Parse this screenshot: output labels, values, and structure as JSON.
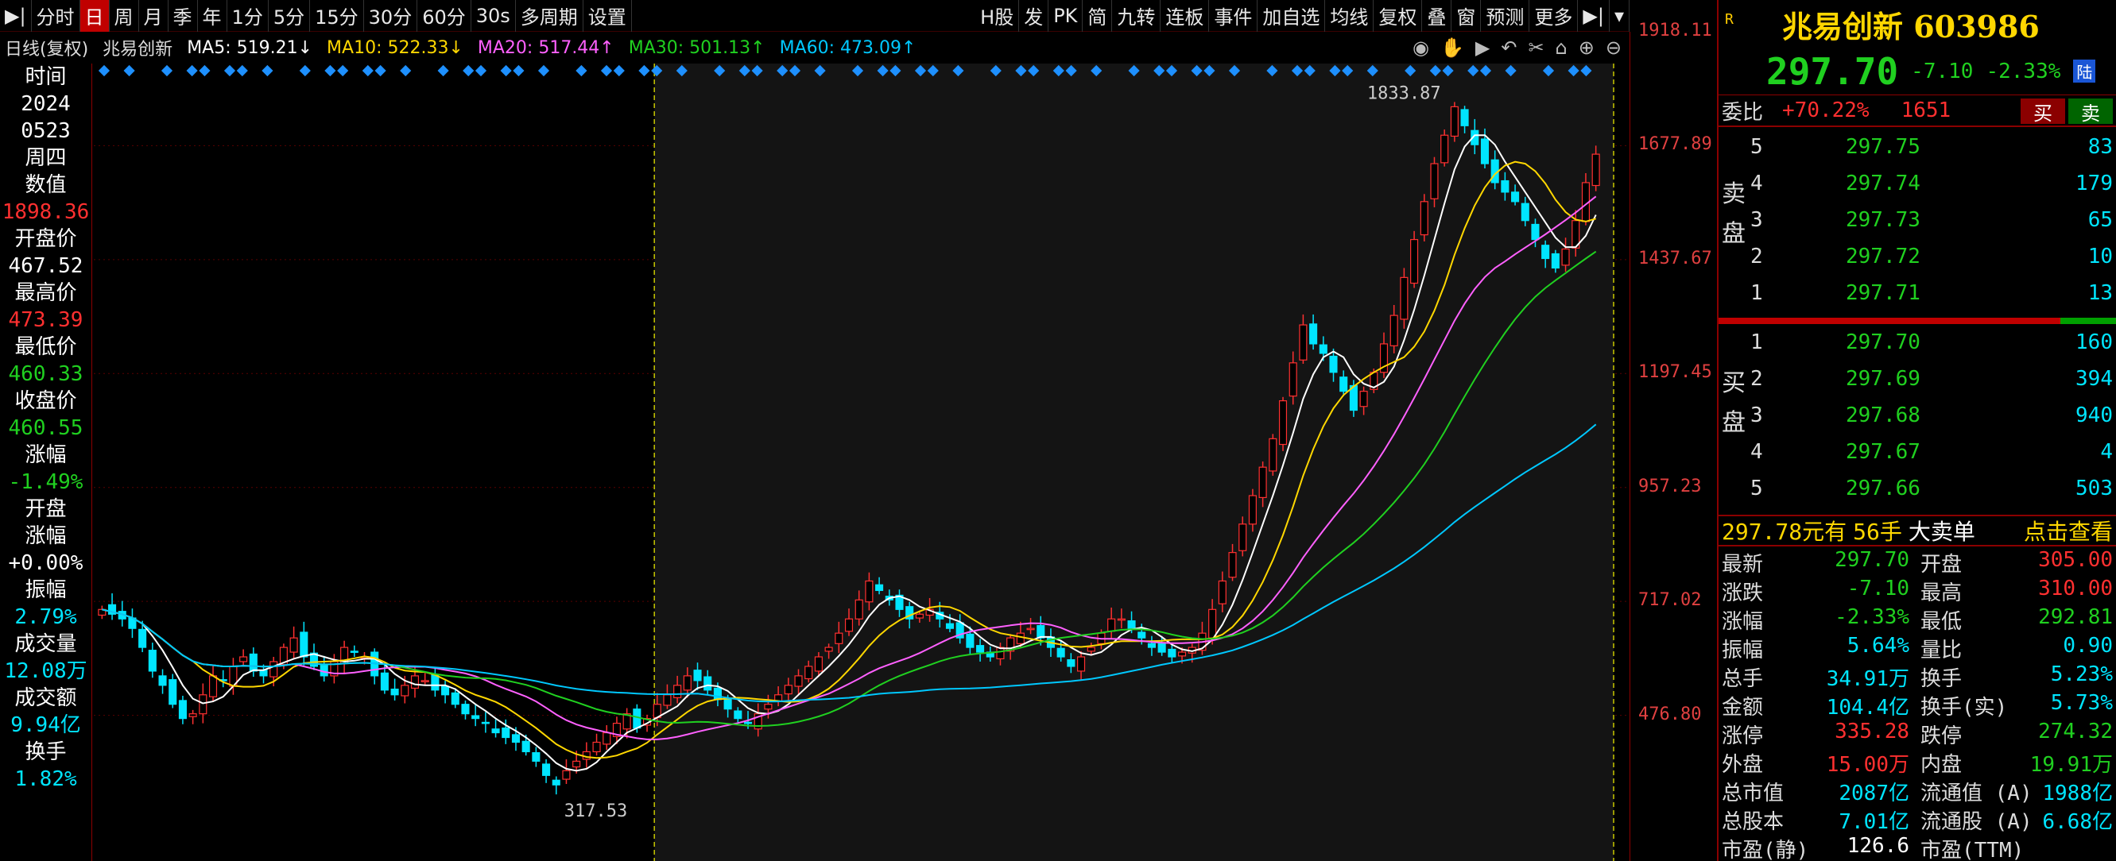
{
  "toolbar": {
    "periods": [
      "分时",
      "日",
      "周",
      "月",
      "季",
      "年",
      "1分",
      "5分",
      "15分",
      "30分",
      "60分",
      "30s",
      "多周期",
      "设置"
    ],
    "active_period": "日",
    "right_tools": [
      "H股",
      "发",
      "PK",
      "简",
      "九转",
      "连板",
      "事件",
      "加自选",
      "均线",
      "复权",
      "叠",
      "窗",
      "预测",
      "更多"
    ]
  },
  "ma_legend": {
    "mode": "日线(复权)",
    "stock": "兆易创新",
    "ma5": "MA5: 519.21↓",
    "ma10": "MA10: 522.33↓",
    "ma20": "MA20: 517.44↑",
    "ma30": "MA30: 501.13↑",
    "ma60": "MA60: 473.09↑",
    "colors": {
      "ma5": "#ffffff",
      "ma10": "#ffd700",
      "ma20": "#ff60ff",
      "ma30": "#20d020",
      "ma60": "#00c8ff"
    }
  },
  "left_panel": [
    {
      "text": "时间",
      "color": "#ffffff"
    },
    {
      "text": "2024",
      "color": "#ffffff"
    },
    {
      "text": "0523",
      "color": "#ffffff"
    },
    {
      "text": "周四",
      "color": "#ffffff"
    },
    {
      "text": "数值",
      "color": "#ffffff"
    },
    {
      "text": "1898.36",
      "color": "#ff3030"
    },
    {
      "text": "开盘价",
      "color": "#ffffff"
    },
    {
      "text": "467.52",
      "color": "#ffffff"
    },
    {
      "text": "最高价",
      "color": "#ffffff"
    },
    {
      "text": "473.39",
      "color": "#ff3030"
    },
    {
      "text": "最低价",
      "color": "#ffffff"
    },
    {
      "text": "460.33",
      "color": "#20d020"
    },
    {
      "text": "收盘价",
      "color": "#ffffff"
    },
    {
      "text": "460.55",
      "color": "#20d020"
    },
    {
      "text": "涨幅",
      "color": "#ffffff"
    },
    {
      "text": "-1.49%",
      "color": "#20d020"
    },
    {
      "text": "开盘",
      "color": "#ffffff"
    },
    {
      "text": "涨幅",
      "color": "#ffffff"
    },
    {
      "text": "+0.00%",
      "color": "#ffffff"
    },
    {
      "text": "振幅",
      "color": "#ffffff"
    },
    {
      "text": "2.79%",
      "color": "#00e5ff"
    },
    {
      "text": "成交量",
      "color": "#ffffff"
    },
    {
      "text": "12.08万",
      "color": "#00e5ff"
    },
    {
      "text": "成交额",
      "color": "#ffffff"
    },
    {
      "text": "9.94亿",
      "color": "#00e5ff"
    },
    {
      "text": "换手",
      "color": "#ffffff"
    },
    {
      "text": "1.82%",
      "color": "#00e5ff"
    }
  ],
  "y_axis_labels": [
    "1918.11",
    "1677.89",
    "1437.67",
    "1197.45",
    "957.23",
    "717.02",
    "476.80"
  ],
  "annotations": {
    "high": "1833.87",
    "low": "317.53"
  },
  "chart_data": {
    "type": "line",
    "y_range": [
      236.58,
      1918.11
    ],
    "close": [
      700,
      690,
      680,
      660,
      620,
      570,
      540,
      500,
      470,
      480,
      520,
      560,
      550,
      580,
      600,
      570,
      560,
      590,
      620,
      640,
      600,
      580,
      560,
      590,
      620,
      610,
      600,
      560,
      530,
      520,
      540,
      560,
      550,
      530,
      520,
      500,
      480,
      470,
      460,
      440,
      430,
      420,
      400,
      380,
      350,
      330,
      360,
      380,
      400,
      420,
      440,
      460,
      480,
      450,
      470,
      500,
      520,
      540,
      560,
      550,
      530,
      510,
      490,
      470,
      460,
      480,
      500,
      520,
      540,
      560,
      580,
      600,
      620,
      650,
      680,
      720,
      760,
      740,
      720,
      700,
      680,
      690,
      700,
      680,
      660,
      640,
      620,
      610,
      600,
      620,
      640,
      650,
      660,
      640,
      620,
      600,
      580,
      600,
      620,
      650,
      680,
      680,
      660,
      640,
      620,
      610,
      600,
      610,
      620,
      650,
      700,
      760,
      820,
      880,
      940,
      1000,
      1060,
      1140,
      1220,
      1300,
      1260,
      1240,
      1200,
      1160,
      1120,
      1160,
      1200,
      1260,
      1320,
      1400,
      1480,
      1560,
      1640,
      1700,
      1760,
      1720,
      1680,
      1640,
      1600,
      1580,
      1560,
      1520,
      1480,
      1440,
      1420,
      1460,
      1520,
      1600,
      1660
    ],
    "ma_series": [
      {
        "name": "MA5",
        "color": "#ffffff"
      },
      {
        "name": "MA10",
        "color": "#ffd700"
      },
      {
        "name": "MA20",
        "color": "#ff60ff"
      },
      {
        "name": "MA30",
        "color": "#20d020"
      },
      {
        "name": "MA60",
        "color": "#00c8ff"
      }
    ],
    "grid": true
  },
  "quote": {
    "badge": "R",
    "name": "兆易创新 603986",
    "price": "297.70",
    "change": "-7.10",
    "change_pct": "-2.33%",
    "market_badge": "陆",
    "webi_label": "委比",
    "webi_pct": "+70.22%",
    "webi_num": "1651",
    "buy_btn": "买",
    "sell_btn": "卖",
    "sell_label": [
      "卖",
      "盘"
    ],
    "buy_label": [
      "买",
      "盘"
    ],
    "asks": [
      {
        "lvl": "5",
        "px": "297.75",
        "vol": "83"
      },
      {
        "lvl": "4",
        "px": "297.74",
        "vol": "179"
      },
      {
        "lvl": "3",
        "px": "297.73",
        "vol": "65"
      },
      {
        "lvl": "2",
        "px": "297.72",
        "vol": "10"
      },
      {
        "lvl": "1",
        "px": "297.71",
        "vol": "13"
      }
    ],
    "bids": [
      {
        "lvl": "1",
        "px": "297.70",
        "vol": "160"
      },
      {
        "lvl": "2",
        "px": "297.69",
        "vol": "394"
      },
      {
        "lvl": "3",
        "px": "297.68",
        "vol": "940"
      },
      {
        "lvl": "4",
        "px": "297.67",
        "vol": "4"
      },
      {
        "lvl": "5",
        "px": "297.66",
        "vol": "503"
      }
    ],
    "big_order": {
      "amount": "297.78元有",
      "hands": "56手",
      "label": "大卖单",
      "link": "点击查看"
    },
    "stats": [
      {
        "k1": "最新",
        "v1": "297.70",
        "c1": "#20d020",
        "k2": "开盘",
        "v2": "305.00",
        "c2": "#ff3030"
      },
      {
        "k1": "涨跌",
        "v1": "-7.10",
        "c1": "#20d020",
        "k2": "最高",
        "v2": "310.00",
        "c2": "#ff3030"
      },
      {
        "k1": "涨幅",
        "v1": "-2.33%",
        "c1": "#20d020",
        "k2": "最低",
        "v2": "292.81",
        "c2": "#20d020"
      },
      {
        "k1": "振幅",
        "v1": "5.64%",
        "c1": "#00e5ff",
        "k2": "量比",
        "v2": "0.90",
        "c2": "#00e5ff"
      },
      {
        "k1": "总手",
        "v1": "34.91万",
        "c1": "#00e5ff",
        "k2": "换手",
        "v2": "5.23%",
        "c2": "#00e5ff"
      },
      {
        "k1": "金额",
        "v1": "104.4亿",
        "c1": "#00e5ff",
        "k2": "换手(实)",
        "v2": "5.73%",
        "c2": "#00e5ff"
      },
      {
        "k1": "涨停",
        "v1": "335.28",
        "c1": "#ff3030",
        "k2": "跌停",
        "v2": "274.32",
        "c2": "#20d020"
      },
      {
        "k1": "外盘",
        "v1": "15.00万",
        "c1": "#ff3030",
        "k2": "内盘",
        "v2": "19.91万",
        "c2": "#20d020"
      },
      {
        "k1": "总市值",
        "v1": "2087亿",
        "c1": "#00e5ff",
        "k2": "流通值 (A)",
        "v2": "1988亿",
        "c2": "#00e5ff"
      },
      {
        "k1": "总股本",
        "v1": "7.01亿",
        "c1": "#00e5ff",
        "k2": "流通股 (A)",
        "v2": "6.68亿",
        "c2": "#00e5ff"
      },
      {
        "k1": "市盈(静)",
        "v1": "126.6",
        "c1": "#ffffff",
        "k2": "市盈(TTM)",
        "v2": "",
        "c2": "#ffffff"
      }
    ]
  }
}
